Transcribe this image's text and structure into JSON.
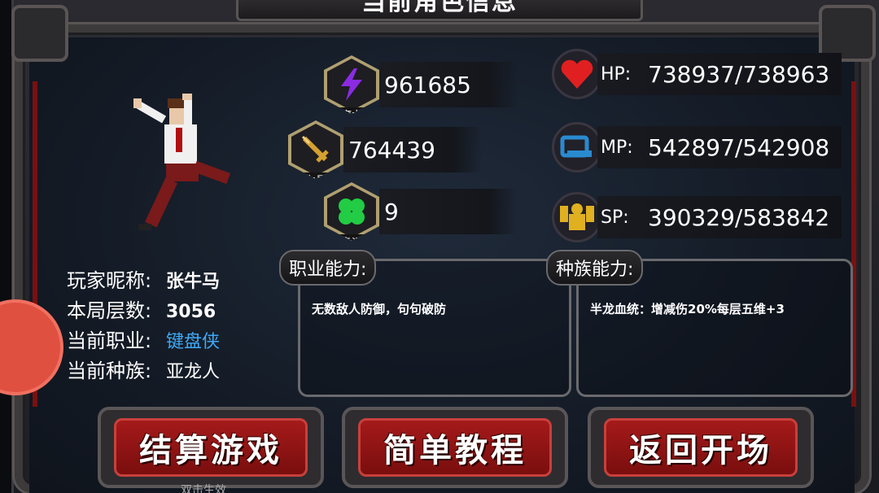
{
  "title": "当前角色信息",
  "player": {
    "nickname_label": "玩家昵称:",
    "nickname": "张牛马",
    "floor_label": "本局层数:",
    "floor": "3056",
    "job_label": "当前职业:",
    "job": "键盘侠",
    "race_label": "当前种族:",
    "race": "亚龙人"
  },
  "stats": {
    "magic": {
      "caption": "魔力",
      "value": "961685",
      "icon": "lightning-icon",
      "color": "#8a2be2"
    },
    "strength": {
      "caption": "力量",
      "value": "764439",
      "icon": "sword-icon",
      "color": "#d4a030"
    },
    "luck": {
      "caption": "幸运",
      "value": "9",
      "icon": "clover-icon",
      "color": "#22cc44"
    }
  },
  "resources": {
    "hp": {
      "label": "HP:",
      "value": "738937/738963",
      "icon": "heart-icon",
      "color": "#e02020"
    },
    "mp": {
      "label": "MP:",
      "value": "542897/542908",
      "icon": "mana-icon",
      "color": "#2a8ad0"
    },
    "sp": {
      "label": "SP:",
      "value": "390329/583842",
      "icon": "muscle-icon",
      "color": "#e0b020"
    }
  },
  "abilities": {
    "job": {
      "label": "职业能力:",
      "description": "无数敌人防御，句句破防"
    },
    "race": {
      "label": "种族能力:",
      "description": "半龙血统：增减伤20%每层五维+3"
    }
  },
  "buttons": {
    "settle": "结算游戏",
    "tutorial": "简单教程",
    "return": "返回开场",
    "settle_sub": "双击生效"
  }
}
